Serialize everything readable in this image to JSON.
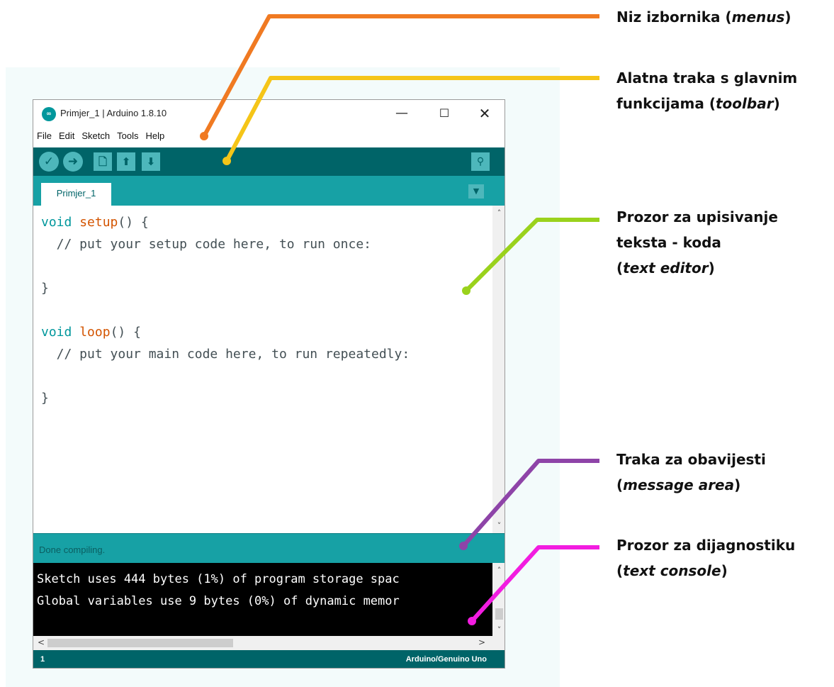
{
  "window": {
    "title": "Primjer_1 | Arduino 1.8.10",
    "logo_text": "∞",
    "controls": {
      "minimize": "—",
      "maximize": "☐",
      "close": "✕"
    }
  },
  "menubar": {
    "items": [
      {
        "label": "File"
      },
      {
        "label": "Edit"
      },
      {
        "label": "Sketch"
      },
      {
        "label": "Tools"
      },
      {
        "label": "Help"
      }
    ]
  },
  "toolbar": {
    "buttons": [
      {
        "name": "verify",
        "icon": "checkmark-icon",
        "glyph": "✓"
      },
      {
        "name": "upload",
        "icon": "arrow-right-icon",
        "glyph": "➜"
      },
      {
        "name": "new",
        "icon": "new-file-icon",
        "glyph": "🗋"
      },
      {
        "name": "open",
        "icon": "arrow-up-icon",
        "glyph": "⬆"
      },
      {
        "name": "save",
        "icon": "arrow-down-icon",
        "glyph": "⬇"
      }
    ],
    "serial_monitor": {
      "icon": "magnifier-icon",
      "glyph": "⚲"
    }
  },
  "tabs": {
    "active": "Primjer_1",
    "menu_glyph": "▼"
  },
  "editor": {
    "lines": [
      {
        "type": "void",
        "fn": "setup",
        "rest": "() {"
      },
      {
        "comment": "  // put your setup code here, to run once:"
      },
      {
        "plain": ""
      },
      {
        "plain": "}"
      },
      {
        "plain": ""
      },
      {
        "type": "void",
        "fn": "loop",
        "rest": "() {"
      },
      {
        "comment": "  // put your main code here, to run repeatedly:"
      },
      {
        "plain": ""
      },
      {
        "plain": "}"
      }
    ]
  },
  "message_area": {
    "text": "Done compiling."
  },
  "console": {
    "lines": [
      "Sketch uses 444 bytes (1%) of program storage spac",
      "Global variables use 9 bytes (0%) of dynamic memor"
    ]
  },
  "scrollbars": {
    "up": "˄",
    "down": "˅",
    "left": "<",
    "right": ">"
  },
  "statusbar": {
    "line_number": "1",
    "board": "Arduino/Genuino Uno"
  },
  "annotations": {
    "menus": {
      "line1": "Niz izbornika (",
      "term": "menus",
      "close": ")",
      "color": "#f07a22"
    },
    "toolbar": {
      "line1": "Alatna traka s glavnim",
      "line2": "funkcijama (",
      "term": "toolbar",
      "close": ")",
      "color": "#f5c518"
    },
    "editor": {
      "line1": "Prozor za upisivanje",
      "line2": "teksta - koda",
      "line3_open": "(",
      "term": "text editor",
      "close": ")",
      "color": "#9ad21c"
    },
    "message": {
      "line1": "Traka za obavijesti",
      "line2_open": "(",
      "term": "message area",
      "close": ")",
      "color": "#8e44a8"
    },
    "console": {
      "line1": "Prozor za dijagnostiku",
      "line2_open": "(",
      "term": "text console",
      "close": ")",
      "color": "#f21ce0"
    }
  }
}
